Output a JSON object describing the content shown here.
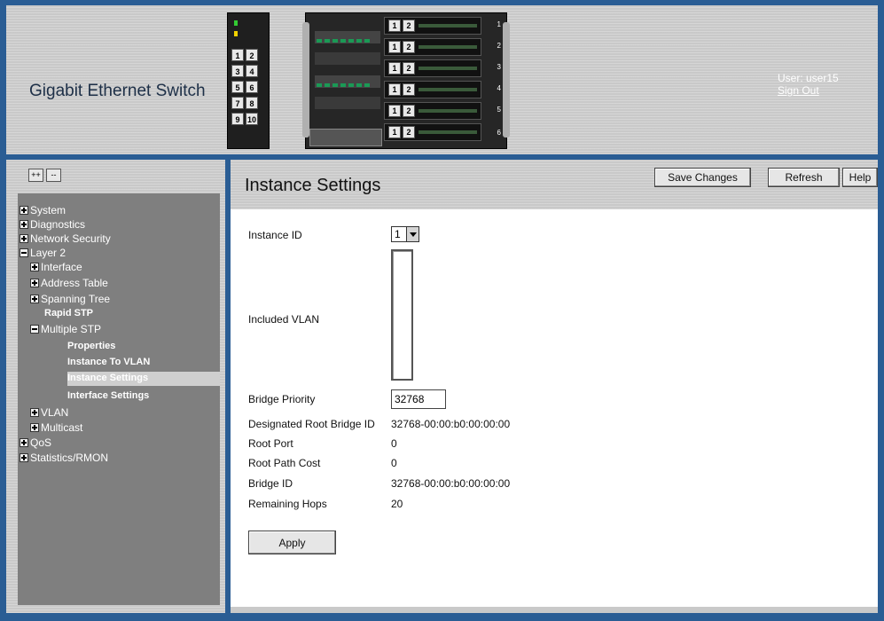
{
  "header": {
    "app_title": "Gigabit Ethernet Switch",
    "user_label": "User: user15",
    "sign_out": "Sign Out",
    "switch_small_ports": [
      [
        "1",
        "2"
      ],
      [
        "3",
        "4"
      ],
      [
        "5",
        "6"
      ],
      [
        "7",
        "8"
      ],
      [
        "9",
        "10"
      ]
    ],
    "switch_big_slots": [
      "1",
      "2",
      "3",
      "4",
      "5",
      "6"
    ],
    "slot_port_labels": [
      "1",
      "2"
    ]
  },
  "sidebar": {
    "expand_all": "++",
    "collapse_all": "--",
    "tree": [
      {
        "label": "System",
        "icon": "plus"
      },
      {
        "label": "Diagnostics",
        "icon": "plus"
      },
      {
        "label": "Network Security",
        "icon": "plus"
      },
      {
        "label": "Layer 2",
        "icon": "minus"
      },
      {
        "label": "Interface",
        "icon": "plus"
      },
      {
        "label": "Address Table",
        "icon": "plus"
      },
      {
        "label": "Spanning Tree",
        "icon": "plus"
      },
      {
        "label": "Rapid STP",
        "icon": "none"
      },
      {
        "label": "Multiple STP",
        "icon": "minus"
      },
      {
        "label": "Properties",
        "icon": "none"
      },
      {
        "label": "Instance To VLAN",
        "icon": "none"
      },
      {
        "label": "Instance Settings",
        "icon": "none",
        "selected": true
      },
      {
        "label": "Interface Settings",
        "icon": "none"
      },
      {
        "label": "VLAN",
        "icon": "plus"
      },
      {
        "label": "Multicast",
        "icon": "plus"
      },
      {
        "label": "QoS",
        "icon": "plus"
      },
      {
        "label": "Statistics/RMON",
        "icon": "plus"
      }
    ]
  },
  "main": {
    "title": "Instance Settings",
    "buttons": {
      "save": "Save Changes",
      "refresh": "Refresh",
      "help": "Help"
    },
    "fields": {
      "instance_id_label": "Instance ID",
      "instance_id_value": "1",
      "included_vlan_label": "Included VLAN",
      "bridge_priority_label": "Bridge Priority",
      "bridge_priority_value": "32768",
      "designated_root_label": "Designated Root Bridge ID",
      "designated_root_value": "32768-00:00:b0:00:00:00",
      "root_port_label": "Root Port",
      "root_port_value": "0",
      "root_path_cost_label": "Root Path Cost",
      "root_path_cost_value": "0",
      "bridge_id_label": "Bridge ID",
      "bridge_id_value": "32768-00:00:b0:00:00:00",
      "remaining_hops_label": "Remaining Hops",
      "remaining_hops_value": "20"
    },
    "apply": "Apply"
  },
  "colors": {
    "frame": "#2a5d94",
    "panel": "#c9c9c9",
    "tree_bg": "#7f7f7f",
    "selected": "#cfcfcf"
  }
}
